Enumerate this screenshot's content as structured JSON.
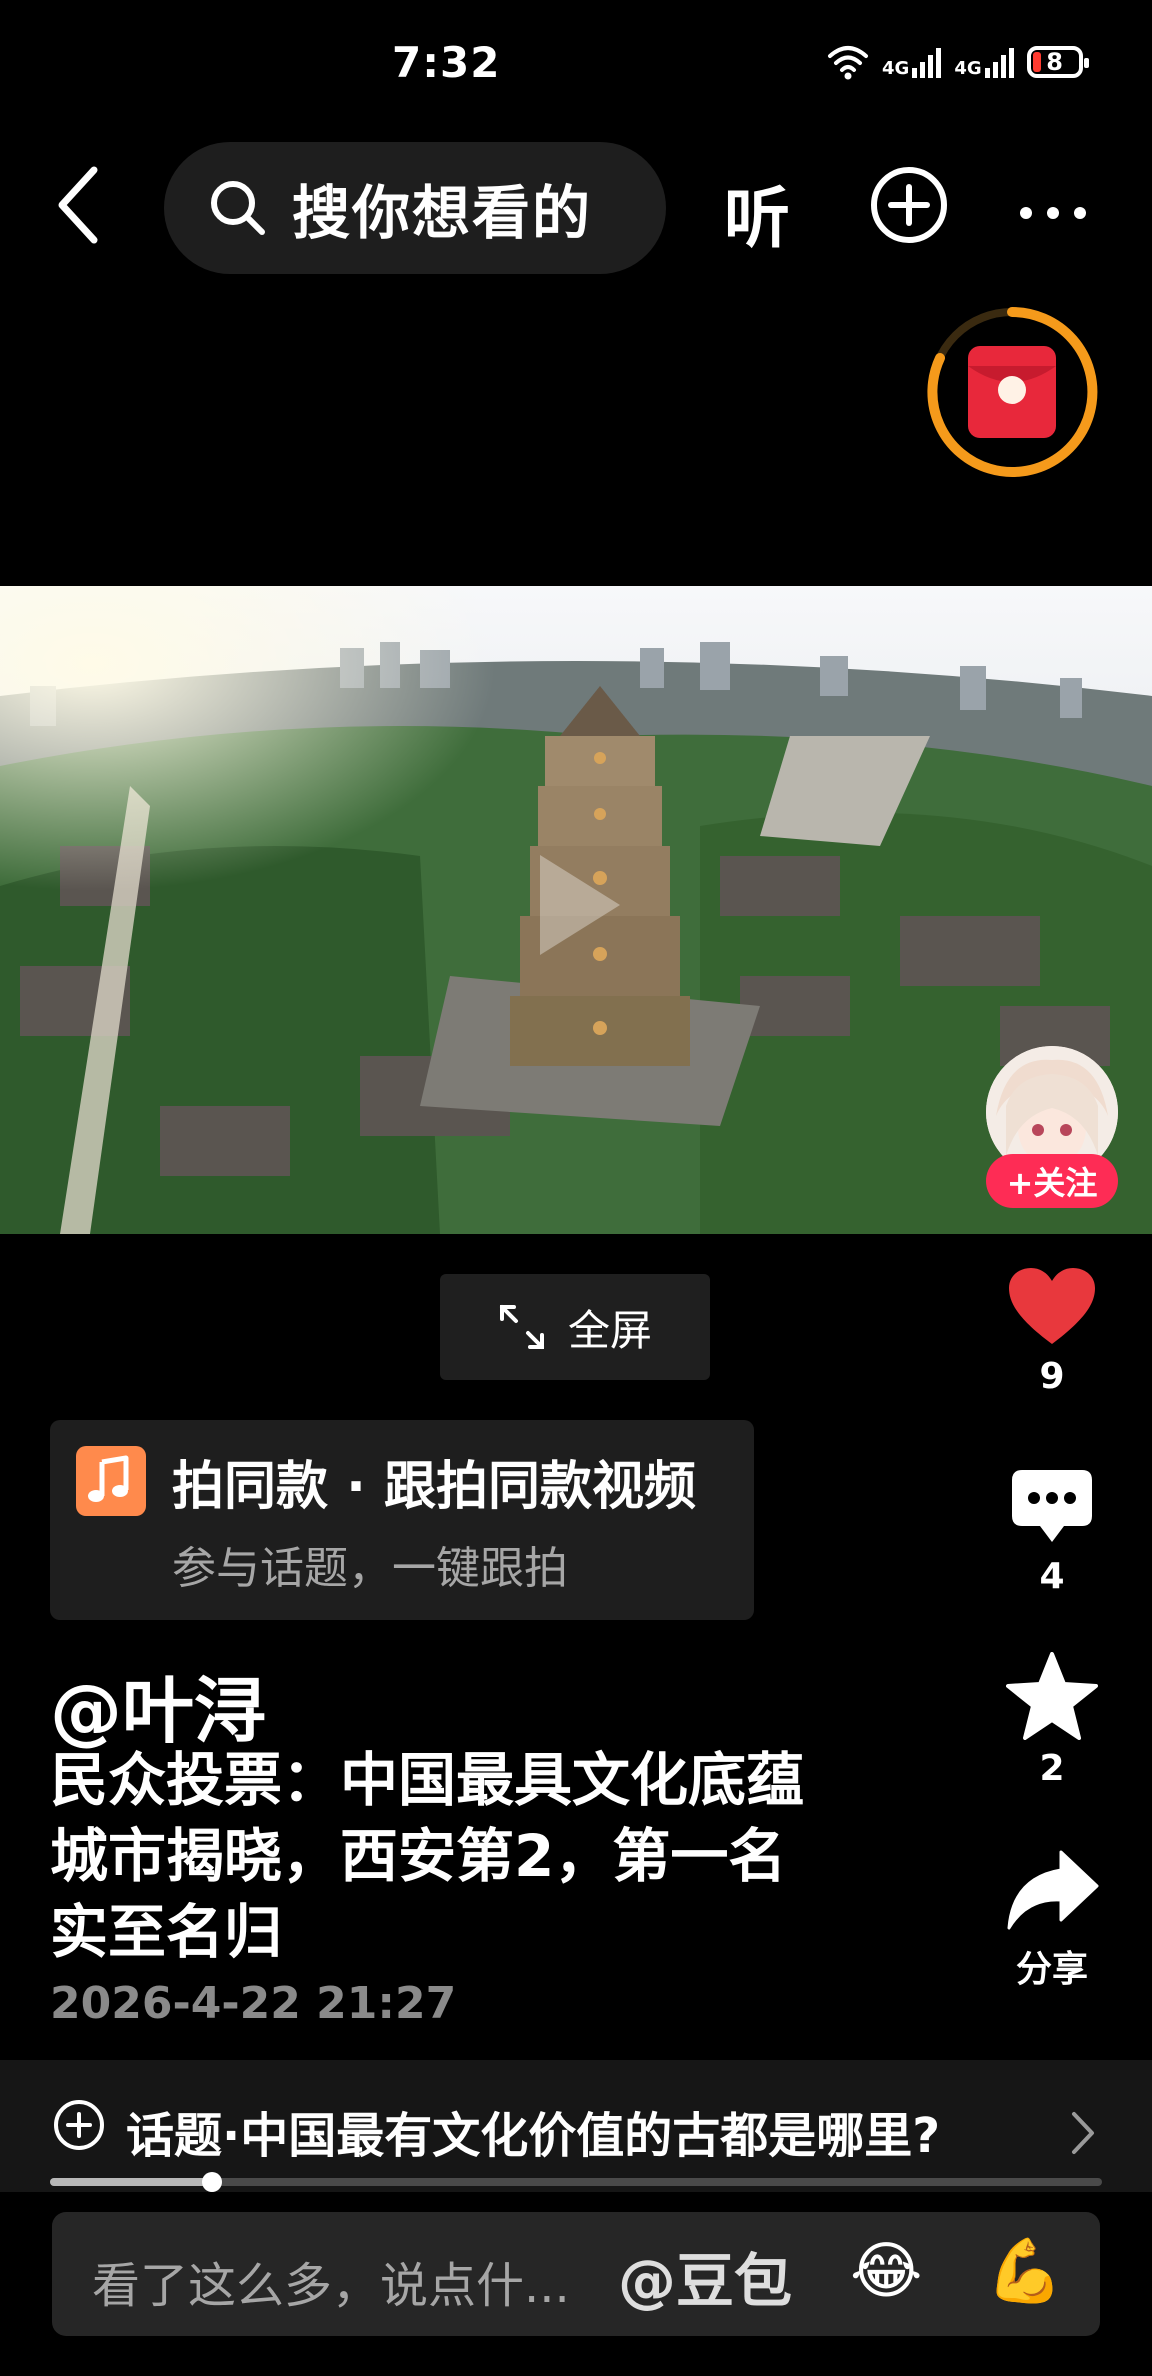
{
  "status_bar": {
    "time": "7:32",
    "network_1": "4G",
    "network_2": "4G",
    "battery": "8"
  },
  "top_nav": {
    "search_placeholder": "搜你想看的",
    "listen_label": "听"
  },
  "video": {
    "follow_label": "+关注",
    "fullscreen_label": "全屏"
  },
  "actions": {
    "likes": "9",
    "comments": "4",
    "favorites": "2",
    "share_label": "分享",
    "like_color": "#e8383d"
  },
  "template_card": {
    "title": "拍同款 · 跟拍同款视频",
    "subtitle": "参与话题，一键跟拍"
  },
  "post": {
    "author": "@叶浔",
    "caption_lines": [
      "民众投票：中国最具文化底蕴",
      "城市揭晓，西安第2，第一名",
      "实至名归"
    ],
    "timestamp": "2026-4-22 21:27"
  },
  "topic": {
    "text": "话题·中国最有文化价值的古都是哪里?"
  },
  "playback": {
    "progress": 0.154
  },
  "comment_bar": {
    "placeholder": "看了这么多，说点什...",
    "mention": "@豆包",
    "emoji_1": "😂",
    "emoji_2": "💪"
  },
  "colors": {
    "accent_red": "#fe2c55",
    "ring_orange": "#f59a1b"
  }
}
